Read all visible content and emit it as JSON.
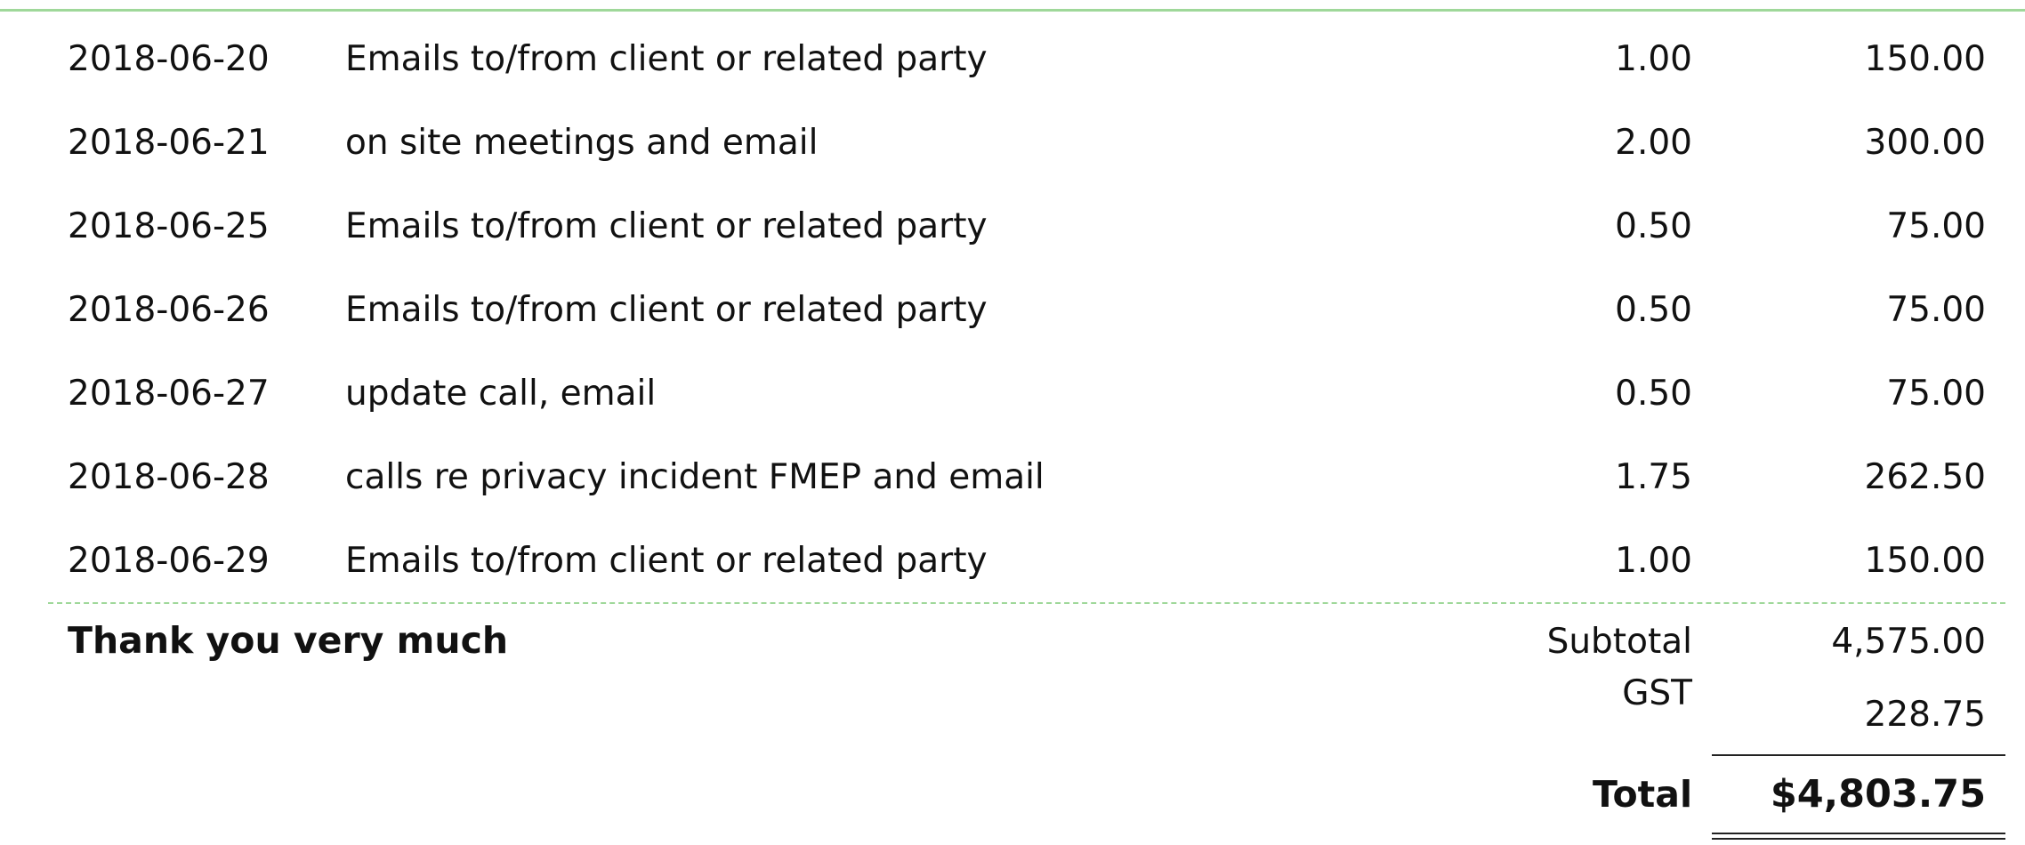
{
  "colors": {
    "accent_rule": "#9fd89a",
    "text": "#111111"
  },
  "line_items": [
    {
      "date": "2018-06-20",
      "description": "Emails to/from client or related party",
      "hours": "1.00",
      "amount": "150.00"
    },
    {
      "date": "2018-06-21",
      "description": "on site meetings and email",
      "hours": "2.00",
      "amount": "300.00"
    },
    {
      "date": "2018-06-25",
      "description": "Emails to/from client or related party",
      "hours": "0.50",
      "amount": "75.00"
    },
    {
      "date": "2018-06-26",
      "description": "Emails to/from client or related party",
      "hours": "0.50",
      "amount": "75.00"
    },
    {
      "date": "2018-06-27",
      "description": "update call, email",
      "hours": "0.50",
      "amount": "75.00"
    },
    {
      "date": "2018-06-28",
      "description": "calls re privacy incident FMEP and email",
      "hours": "1.75",
      "amount": "262.50"
    },
    {
      "date": "2018-06-29",
      "description": "Emails to/from client or related party",
      "hours": "1.00",
      "amount": "150.00"
    }
  ],
  "footer": {
    "thanks": "Thank you very much",
    "subtotal_label": "Subtotal",
    "subtotal_value": "4,575.00",
    "gst_label": "GST",
    "gst_value": "228.75",
    "total_label": "Total",
    "total_value": "$4,803.75"
  }
}
